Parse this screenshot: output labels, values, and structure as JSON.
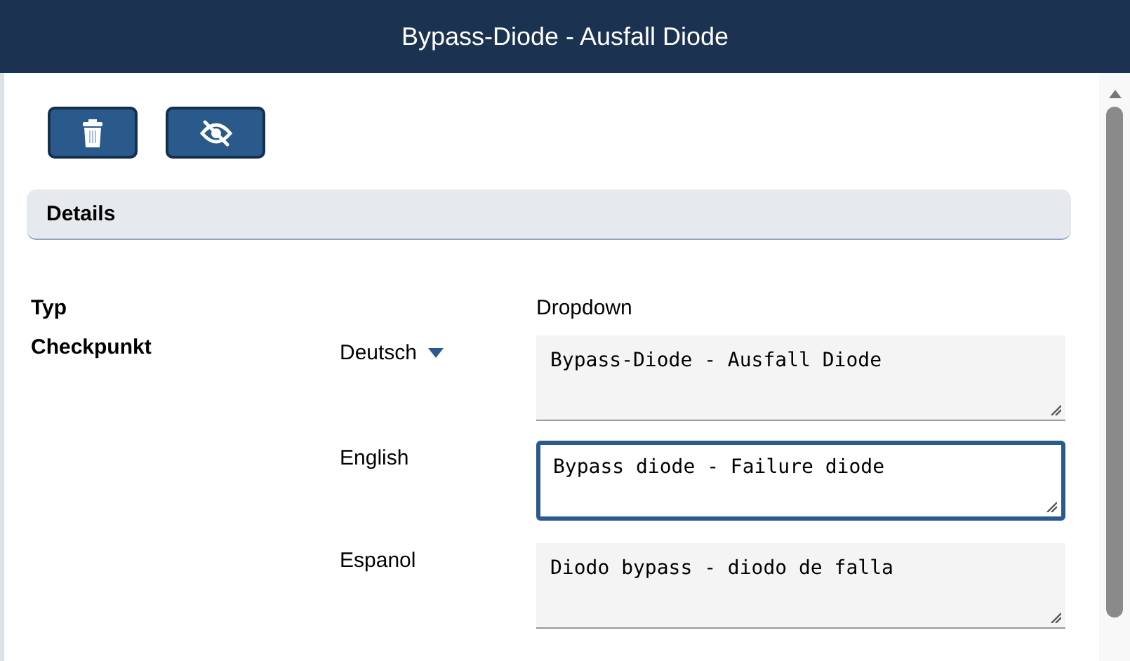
{
  "window": {
    "title": "Bypass-Diode - Ausfall Diode"
  },
  "toolbar": [
    {
      "kind": "delete"
    },
    {
      "kind": "hide"
    }
  ],
  "section": {
    "title": "Details"
  },
  "fields": [
    {
      "label": "Typ",
      "value": "Dropdown"
    }
  ],
  "checkpoint": {
    "label": "Checkpunkt",
    "translations": [
      {
        "language": "Deutsch",
        "kind": "dropdown",
        "value": "Bypass-Diode - Ausfall Diode",
        "focused": false
      },
      {
        "language": "English",
        "kind": "plain",
        "value": "Bypass diode - Failure diode",
        "focused": true
      },
      {
        "language": "Espanol",
        "kind": "plain",
        "value": "Diodo bypass - diodo de falla",
        "focused": false
      }
    ]
  }
}
